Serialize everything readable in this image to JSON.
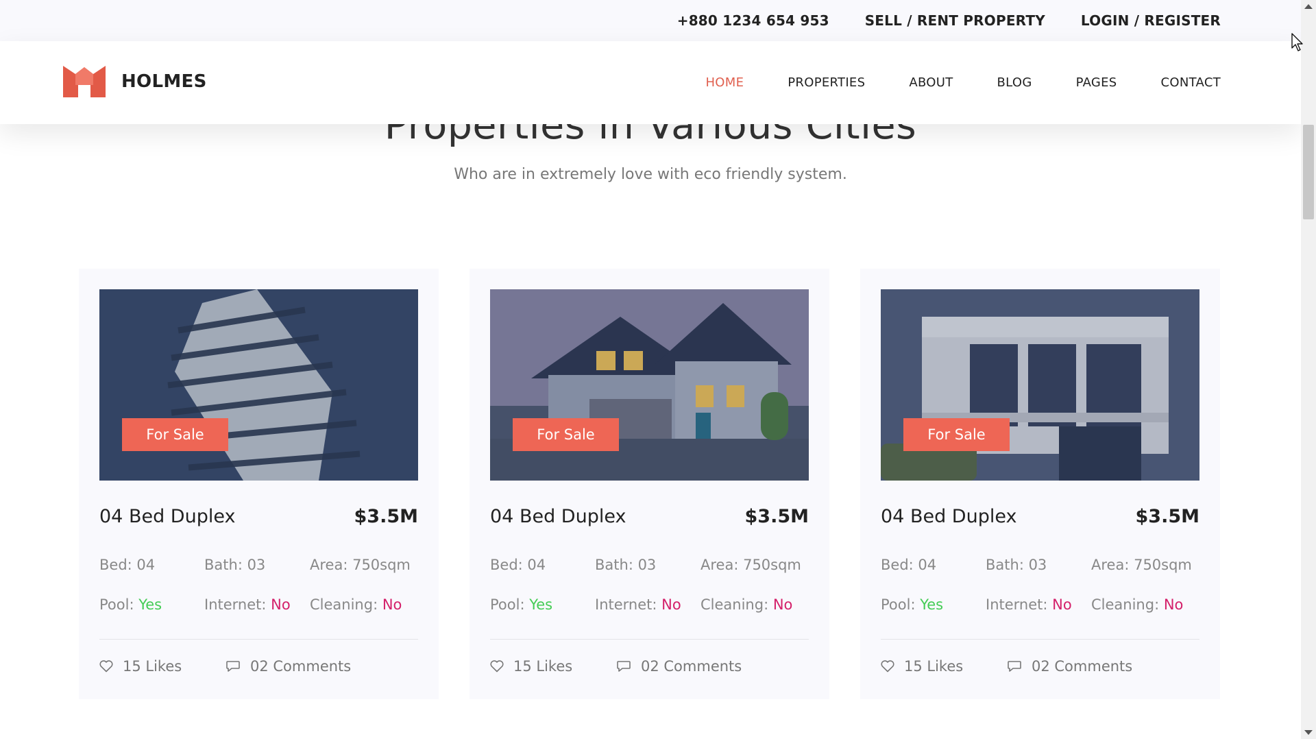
{
  "topbar": {
    "phone": "+880 1234 654 953",
    "sell_rent": "SELL / RENT PROPERTY",
    "login_register": "LOGIN / REGISTER"
  },
  "header": {
    "brand": "HOLMES",
    "nav": [
      "HOME",
      "PROPERTIES",
      "ABOUT",
      "BLOG",
      "PAGES",
      "CONTACT"
    ],
    "active": "HOME"
  },
  "section": {
    "title": "Properties in Various Cities",
    "subtitle": "Who are in extremely love with eco friendly system."
  },
  "cards": [
    {
      "badge": "For Sale",
      "title": "04 Bed Duplex",
      "price": "$3.5M",
      "bed": "Bed: 04",
      "bath": "Bath: 03",
      "area": "Area: 750sqm",
      "pool_label": "Pool: ",
      "pool": "Yes",
      "internet_label": "Internet: ",
      "internet": "No",
      "cleaning_label": "Cleaning: ",
      "cleaning": "No",
      "likes": "15 Likes",
      "comments": "02 Comments"
    },
    {
      "badge": "For Sale",
      "title": "04 Bed Duplex",
      "price": "$3.5M",
      "bed": "Bed: 04",
      "bath": "Bath: 03",
      "area": "Area: 750sqm",
      "pool_label": "Pool: ",
      "pool": "Yes",
      "internet_label": "Internet: ",
      "internet": "No",
      "cleaning_label": "Cleaning: ",
      "cleaning": "No",
      "likes": "15 Likes",
      "comments": "02 Comments"
    },
    {
      "badge": "For Sale",
      "title": "04 Bed Duplex",
      "price": "$3.5M",
      "bed": "Bed: 04",
      "bath": "Bath: 03",
      "area": "Area: 750sqm",
      "pool_label": "Pool: ",
      "pool": "Yes",
      "internet_label": "Internet: ",
      "internet": "No",
      "cleaning_label": "Cleaning: ",
      "cleaning": "No",
      "likes": "15 Likes",
      "comments": "02 Comments"
    }
  ],
  "colors": {
    "accent": "#ee6655",
    "yes": "#44cc55",
    "no": "#d4206a"
  },
  "icons": {
    "logo": "house-logo-icon",
    "like": "heart-icon",
    "comment": "comment-icon"
  }
}
